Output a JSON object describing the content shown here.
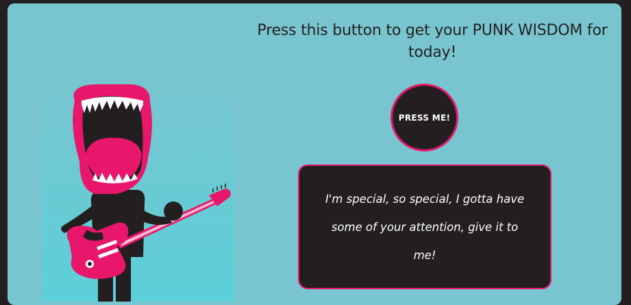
{
  "colors": {
    "page_background": "#231f20",
    "card_background": "#78c5cf",
    "accent_pink": "#e8176c",
    "dark": "#231f20"
  },
  "heading": "Press this button to get your PUNK WISDOM for today!",
  "button": {
    "label": "PRESS ME!"
  },
  "quote": {
    "text": "I'm special, so special, I gotta have some of your attention, give it to me!"
  },
  "illustration": {
    "icon": "punk-mouth-guitarist-illustration"
  }
}
